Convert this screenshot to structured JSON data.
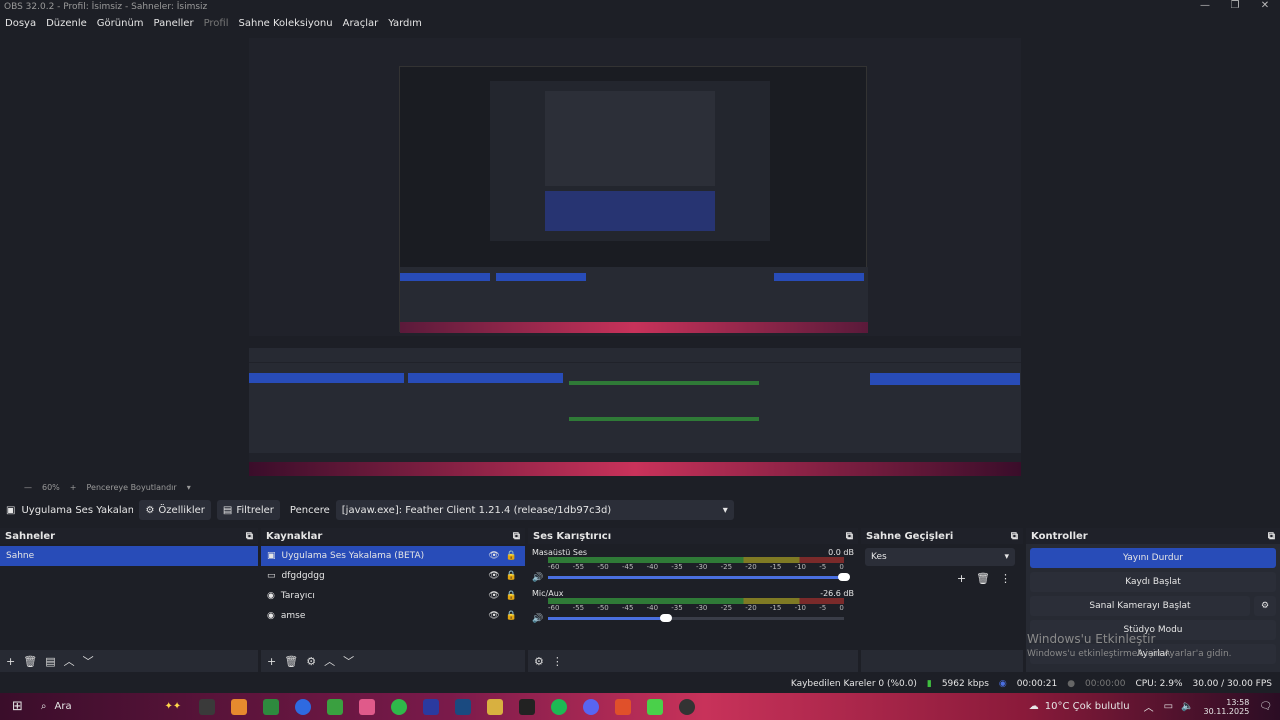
{
  "window": {
    "title": "OBS 32.0.2 - Profil: İsimsiz - Sahneler: İsimsiz"
  },
  "menu": [
    {
      "label": "Dosya",
      "dim": false
    },
    {
      "label": "Düzenle",
      "dim": false
    },
    {
      "label": "Görünüm",
      "dim": false
    },
    {
      "label": "Paneller",
      "dim": false
    },
    {
      "label": "Profil",
      "dim": true
    },
    {
      "label": "Sahne Koleksiyonu",
      "dim": false
    },
    {
      "label": "Araçlar",
      "dim": false
    },
    {
      "label": "Yardım",
      "dim": false
    }
  ],
  "zoom": {
    "percent": "60%",
    "fit_label": "Pencereye Boyutlandır"
  },
  "sourcebar": {
    "source_name": "Uygulama Ses Yakalama (Bi",
    "properties": "Özellikler",
    "filters": "Filtreler",
    "window_label": "Pencere",
    "window_value": "[javaw.exe]: Feather Client 1.21.4 (release/1db97c3d)"
  },
  "scenes": {
    "title": "Sahneler",
    "items": [
      "Sahne"
    ]
  },
  "sources": {
    "title": "Kaynaklar",
    "items": [
      "Uygulama Ses Yakalama (BETA)",
      "dfgdgdgg",
      "Tarayıcı",
      "amse"
    ]
  },
  "mixer": {
    "title": "Ses Karıştırıcı",
    "channels": [
      {
        "name": "Masaüstü Ses",
        "db": "0.0 dB",
        "volume": 1.0
      },
      {
        "name": "Mic/Aux",
        "db": "-26.6 dB",
        "volume": 0.4
      }
    ],
    "ticks": [
      "-60",
      "-55",
      "-50",
      "-45",
      "-40",
      "-35",
      "-30",
      "-25",
      "-20",
      "-15",
      "-10",
      "-5",
      "0"
    ]
  },
  "transitions": {
    "title": "Sahne Geçişleri",
    "value": "Kes"
  },
  "controls": {
    "title": "Kontroller",
    "stop_stream": "Yayını Durdur",
    "start_record": "Kaydı Başlat",
    "virtual_cam": "Sanal Kamerayı Başlat",
    "studio_mode": "Stüdyo Modu",
    "settings": "Ayarlar"
  },
  "watermark": {
    "line1": "Windows'u Etkinleştir",
    "line2": "Windows'u etkinleştirmek için Ayarlar'a gidin."
  },
  "status": {
    "dropped": "Kaybedilen Kareler 0 (%0.0)",
    "bitrate": "5962 kbps",
    "stream_time": "00:00:21",
    "rec_time": "00:00:00",
    "cpu": "CPU: 2.9%",
    "fps": "30.00 / 30.00 FPS"
  },
  "taskbar": {
    "search": "Ara",
    "weather": "10°C  Çok bulutlu",
    "time": "13:58",
    "date": "30.11.2025"
  }
}
